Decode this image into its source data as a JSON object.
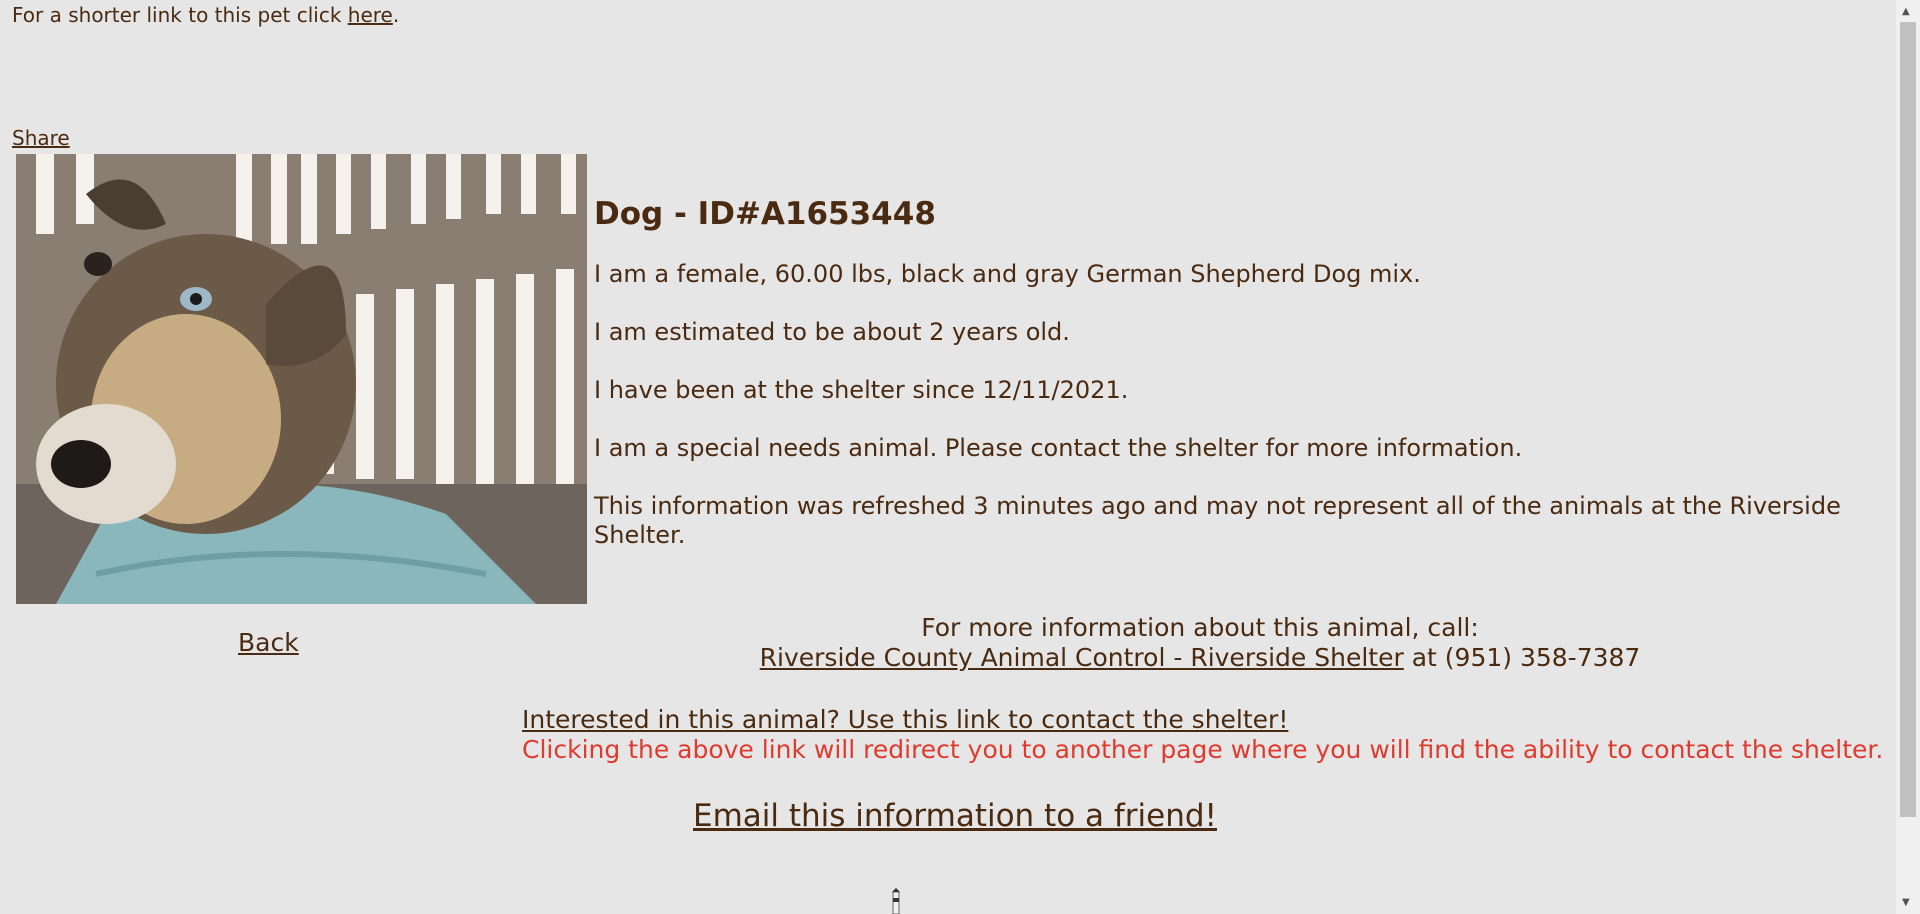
{
  "top": {
    "prefix": "For a shorter link to this pet click ",
    "link": "here",
    "suffix": "."
  },
  "share_label": "Share",
  "photo": {
    "alt": "Dog photo",
    "icon": "dog-photo"
  },
  "animal": {
    "title": "Dog - ID#A1653448",
    "lines": [
      "I am a female, 60.00 lbs, black and gray German Shepherd Dog mix.",
      "I am estimated to be about 2 years old.",
      "I have been at the shelter since 12/11/2021.",
      "I am a special needs animal. Please contact the shelter for more information.",
      "This information was refreshed 3 minutes ago and may not represent all of the animals at the Riverside Shelter."
    ]
  },
  "back_label": "Back",
  "contact": {
    "heading": "For more information about this animal, call:",
    "shelter": "Riverside County Animal Control - Riverside Shelter",
    "phone_prefix": " at ",
    "phone": "(951) 358-7387"
  },
  "interest": {
    "link": "Interested in this animal? Use this link to contact the shelter!",
    "note": "Clicking the above link will redirect you to another page where you will find the ability to contact the shelter."
  },
  "email_label": "Email this information to a friend!",
  "colors": {
    "text": "#4a2a10",
    "background": "#e6e6e6",
    "warning": "#e03a2e"
  }
}
